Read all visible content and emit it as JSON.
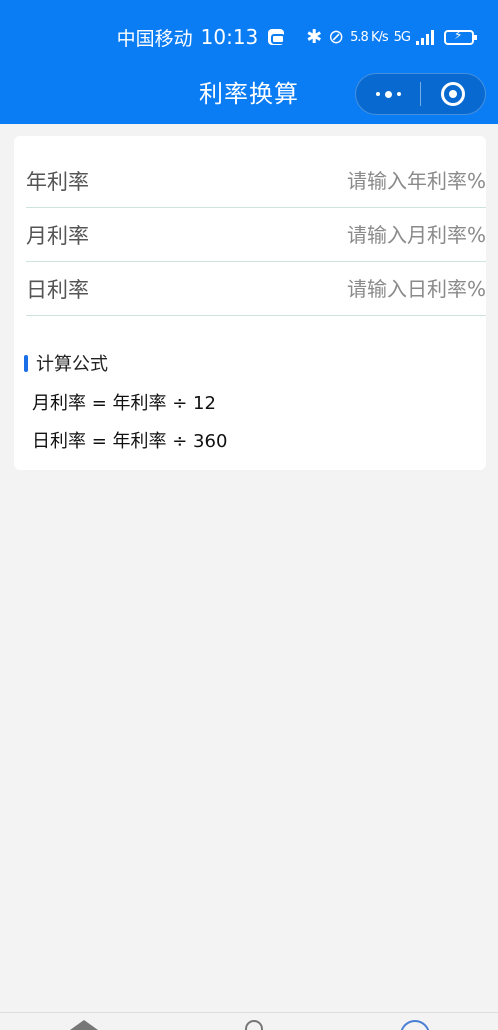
{
  "status_bar": {
    "carrier": "中国移动",
    "time": "10:13",
    "net_speed_top": "5.8",
    "net_speed_bottom": "K/s",
    "network": "5G",
    "icons": [
      "message-icon",
      "bluetooth-icon",
      "mute-icon",
      "signal-icon",
      "battery-icon"
    ]
  },
  "nav": {
    "title": "利率换算",
    "more_icon": "more-dots-icon",
    "close_icon": "close-circle-icon"
  },
  "form": {
    "fields": [
      {
        "label": "年利率",
        "placeholder": "请输入年利率%",
        "value": ""
      },
      {
        "label": "月利率",
        "placeholder": "请输入月利率%",
        "value": ""
      },
      {
        "label": "日利率",
        "placeholder": "请输入日利率%",
        "value": ""
      }
    ]
  },
  "formula": {
    "title": "计算公式",
    "lines": [
      "月利率 = 年利率 ÷ 12",
      "日利率 = 年利率 ÷ 360"
    ]
  },
  "tabbar": {
    "icons": [
      "home-icon",
      "tool-icon",
      "profile-icon"
    ]
  },
  "colors": {
    "header": "#0a7cf4",
    "accent": "#1a6fe8",
    "background": "#f3f3f3"
  }
}
